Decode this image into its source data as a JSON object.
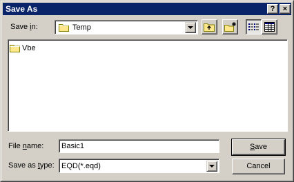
{
  "window": {
    "title": "Save As",
    "help_label": "?",
    "close_label": "×"
  },
  "save_in": {
    "label_prefix": "Save ",
    "label_mnemonic": "i",
    "label_suffix": "n:",
    "value": "Temp",
    "icon": "folder-icon"
  },
  "toolbar": {
    "up_icon": "up-one-level-icon",
    "new_folder_icon": "new-folder-icon",
    "list_view_icon": "list-view-icon",
    "details_view_icon": "details-view-icon"
  },
  "files": [
    {
      "name": "Vbe",
      "icon": "folder-icon"
    }
  ],
  "file_name": {
    "label_prefix": "File ",
    "label_mnemonic": "n",
    "label_suffix": "ame:",
    "value": "Basic1"
  },
  "save_type": {
    "label_prefix": "Save as ",
    "label_mnemonic": "t",
    "label_suffix": "ype:",
    "value": "EQD(*.eqd)"
  },
  "buttons": {
    "save_mnemonic": "S",
    "save_rest": "ave",
    "cancel": "Cancel"
  },
  "colors": {
    "title_bar": "#0a246a",
    "face": "#d4d0c8",
    "folder_yellow": "#ffe88c"
  }
}
